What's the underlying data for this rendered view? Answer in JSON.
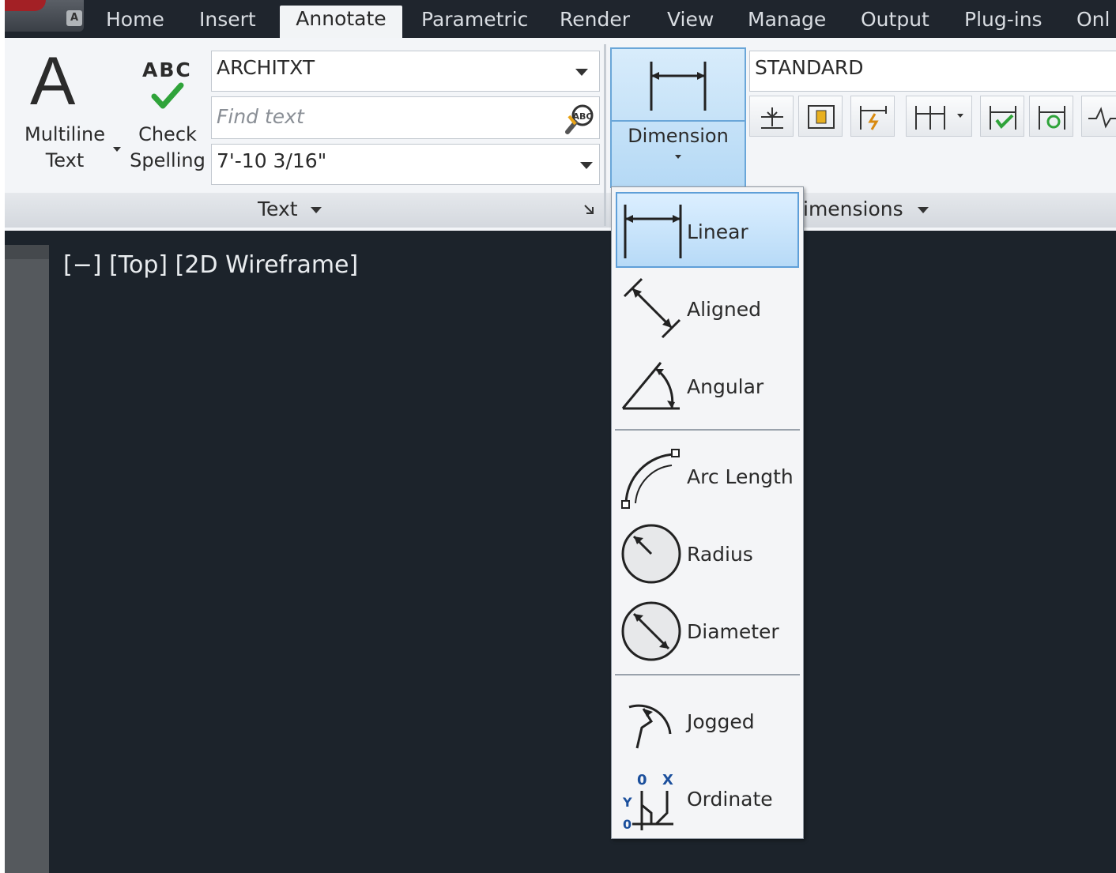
{
  "tabs": [
    "Home",
    "Insert",
    "Annotate",
    "Parametric",
    "Render",
    "View",
    "Manage",
    "Output",
    "Plug-ins",
    "Onl"
  ],
  "active_tab": "Annotate",
  "app_badge": "A",
  "text_panel": {
    "multiline_line1": "Multiline",
    "multiline_line2": "Text",
    "check_top": "ABC",
    "check_line1": "Check",
    "check_line2": "Spelling",
    "text_style": "ARCHITXT",
    "find_placeholder": "Find text",
    "find_icon_text": "ABC",
    "text_height": "7'-10 3/16\"",
    "panel_title": "Text"
  },
  "dimension_panel": {
    "button_label": "Dimension",
    "dim_style": "STANDARD",
    "panel_title": "imensions"
  },
  "viewport": {
    "label": "[−] [Top] [2D Wireframe]"
  },
  "menu": {
    "items": [
      {
        "label": "Linear",
        "icon": "linear-dimension-icon",
        "highlighted": true
      },
      {
        "label": "Aligned",
        "icon": "aligned-dimension-icon"
      },
      {
        "label": "Angular",
        "icon": "angular-dimension-icon"
      },
      {
        "label": "Arc Length",
        "icon": "arc-length-icon"
      },
      {
        "label": "Radius",
        "icon": "radius-icon"
      },
      {
        "label": "Diameter",
        "icon": "diameter-icon"
      },
      {
        "label": "Jogged",
        "icon": "jogged-icon"
      },
      {
        "label": "Ordinate",
        "icon": "ordinate-icon"
      }
    ],
    "ordinate_glyphs": {
      "y": "Y",
      "x": "X",
      "zero": "0"
    }
  },
  "colors": {
    "highlight": "#b7daf7",
    "viewport_bg": "#1c232b",
    "check_green": "#2fa33a"
  }
}
